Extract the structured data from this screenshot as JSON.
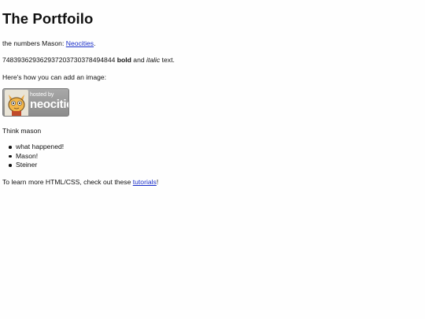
{
  "title": "The Portfoilo",
  "intro": {
    "text": "the numbers Mason: ",
    "link": "Neocities",
    "end": "."
  },
  "numbers_line": {
    "digits": "748393629362937203730378494844 ",
    "bold": "bold",
    "and": " and ",
    "italic": "italic",
    "end": " text."
  },
  "image_heading": "Here's how you can add an image:",
  "badge": {
    "small": "hosted by",
    "big": "neocities"
  },
  "think": "Think mason",
  "list": [
    "what happened!",
    "Mason!",
    "Steiner"
  ],
  "footer": {
    "text": "To learn more HTML/CSS, check out these ",
    "link": "tutorials",
    "end": "!"
  }
}
